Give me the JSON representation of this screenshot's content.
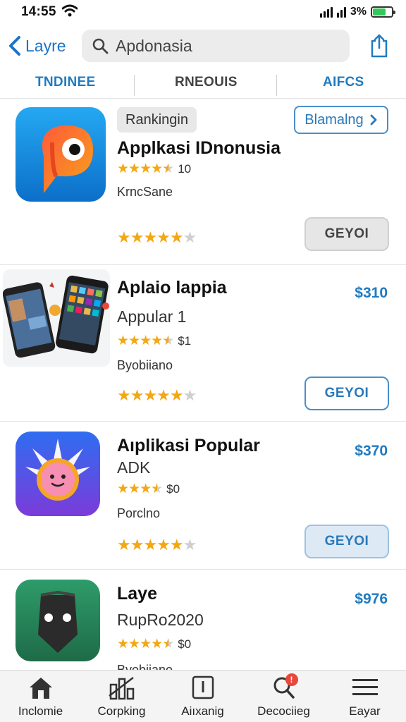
{
  "status_bar": {
    "time": "14:55",
    "carrier": "3%"
  },
  "nav": {
    "back_label": "Layre",
    "search_value": "Apdonasia"
  },
  "tabs": [
    "TNDINEE",
    "RNEOUIS",
    "AIFCS"
  ],
  "apps": [
    {
      "tag": "Rankingin",
      "action_pill": "Blamalng",
      "title": "Applkasi IDnonusia",
      "rating_text": "10",
      "developer": "KrncSane",
      "button": "GEYOI"
    },
    {
      "title": "Aplaio lappia",
      "subtitle": "Appular 1",
      "rating_text": "$1",
      "developer": "Byobiiano",
      "price": "$310",
      "button": "GEYOI"
    },
    {
      "title": "Aıplikasi Popular",
      "subtitle": "ADK",
      "rating_text": "$0",
      "developer": "Porclno",
      "price": "$370",
      "button": "GEYOI"
    },
    {
      "title": "Laye",
      "subtitle": "RupRo2020",
      "rating_text": "$0",
      "developer": "Byobiiano",
      "price": "$976"
    }
  ],
  "tabbar": [
    {
      "label": "Inclomie",
      "icon": "home-icon"
    },
    {
      "label": "Corpking",
      "icon": "ranking-icon"
    },
    {
      "label": "Aiıxanig",
      "icon": "apps-icon"
    },
    {
      "label": "Decociieg",
      "icon": "search-icon",
      "badge": "!"
    },
    {
      "label": "Eayar",
      "icon": "menu-icon"
    }
  ],
  "colors": {
    "accent": "#1f7bc1",
    "star": "#f3a712",
    "battery": "#34c759",
    "badge": "#e8473b"
  }
}
